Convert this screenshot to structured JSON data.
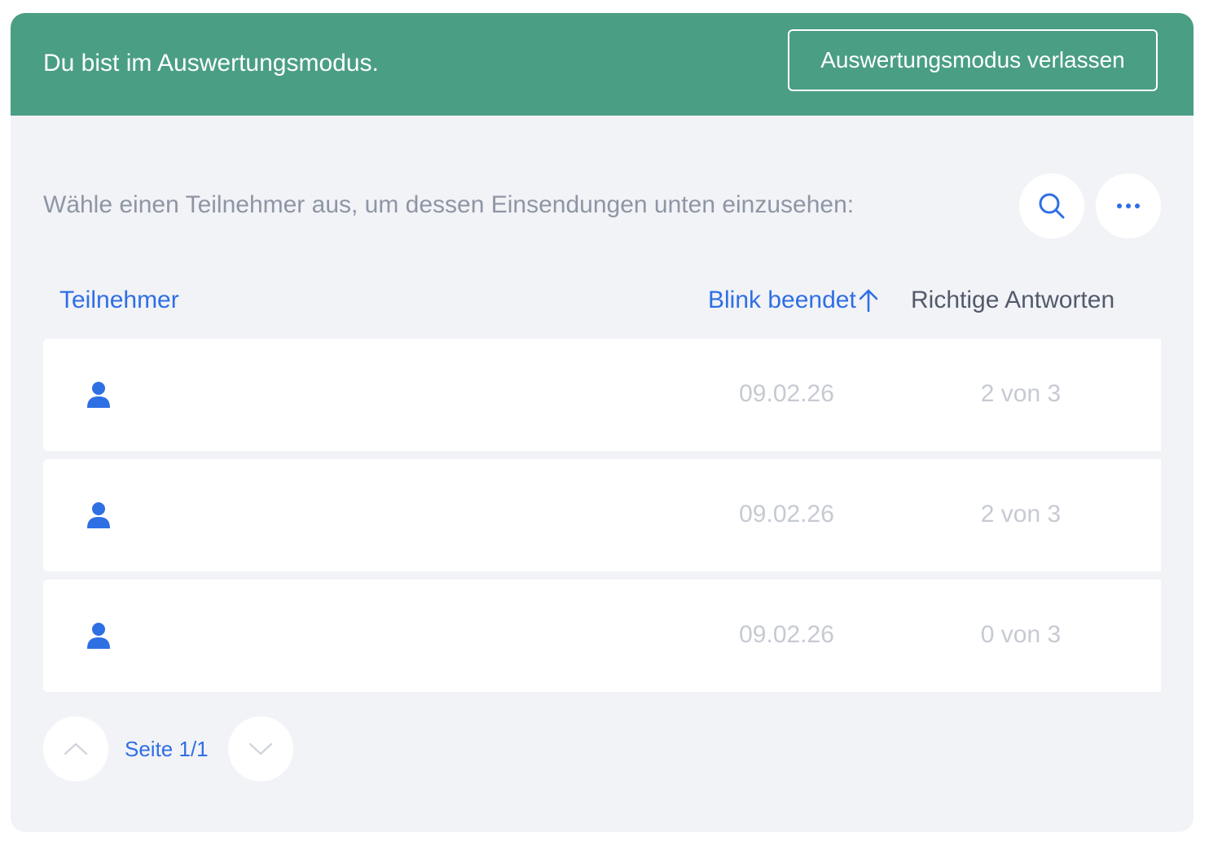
{
  "banner": {
    "text": "Du bist im Auswertungsmodus.",
    "exit_button_label": "Auswertungsmodus verlassen",
    "background_color": "#4a9e84"
  },
  "instruction": "Wähle einen Teilnehmer aus, um dessen Einsendungen unten einzusehen:",
  "toolbar": {
    "search_icon": "search-icon",
    "more_icon": "more-horizontal-icon"
  },
  "table": {
    "headers": {
      "participant": "Teilnehmer",
      "finished": "Blink beendet",
      "correct": "Richtige Antworten"
    },
    "sort": {
      "column": "finished",
      "direction": "ascending",
      "icon": "arrow-up-icon"
    },
    "rows": [
      {
        "icon": "user-icon",
        "date": "09.02.26",
        "score": "2 von 3"
      },
      {
        "icon": "user-icon",
        "date": "09.02.26",
        "score": "2 von 3"
      },
      {
        "icon": "user-icon",
        "date": "09.02.26",
        "score": "0 von 3"
      }
    ]
  },
  "pagination": {
    "label": "Seite 1/1",
    "prev_icon": "chevron-up-icon",
    "next_icon": "chevron-down-icon"
  },
  "colors": {
    "accent": "#2f6fe4",
    "panel_background": "#f2f3f7",
    "muted_text": "#c6cad2"
  }
}
